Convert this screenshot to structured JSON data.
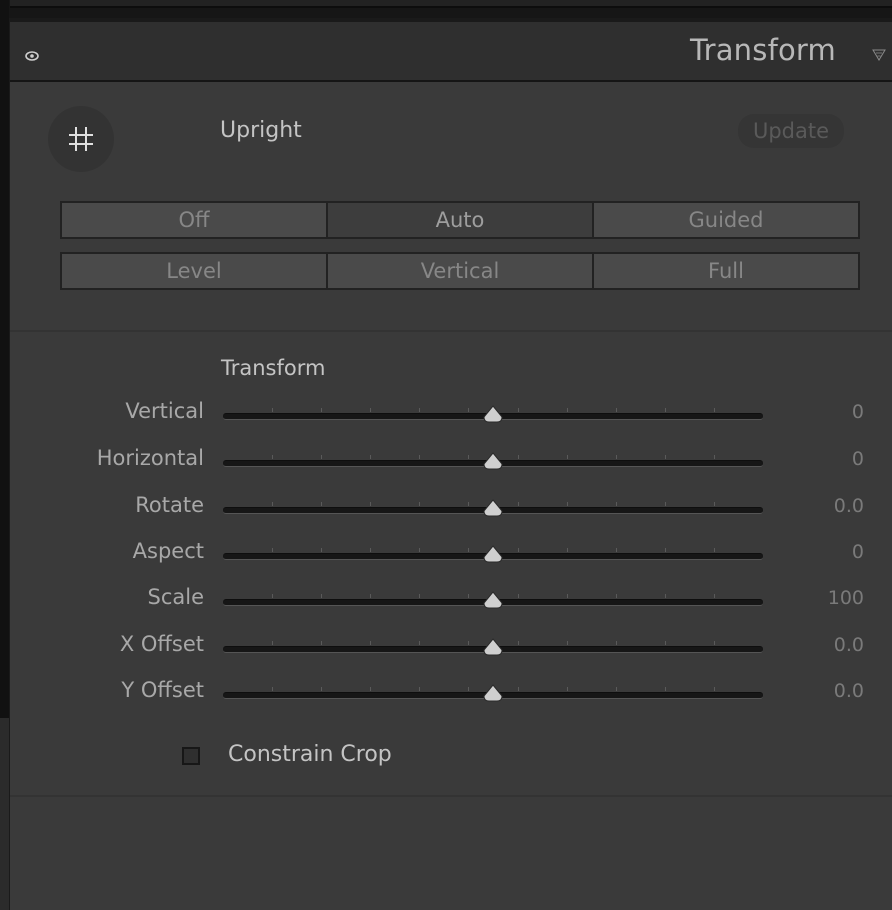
{
  "header": {
    "title": "Transform",
    "visibility_icon": "eye-icon",
    "collapse_icon": "triangle-down-icon"
  },
  "upright": {
    "tool_icon": "crop-grid-icon",
    "label": "Upright",
    "update_label": "Update",
    "modes_row1": [
      "Off",
      "Auto",
      "Guided"
    ],
    "modes_row2": [
      "Level",
      "Vertical",
      "Full"
    ],
    "active_mode": "Auto"
  },
  "transform": {
    "section_title": "Transform",
    "sliders": [
      {
        "label": "Vertical",
        "value": "0",
        "level": 0.5
      },
      {
        "label": "Horizontal",
        "value": "0",
        "level": 0.5
      },
      {
        "label": "Rotate",
        "value": "0.0",
        "level": 0.5
      },
      {
        "label": "Aspect",
        "value": "0",
        "level": 0.5
      },
      {
        "label": "Scale",
        "value": "100",
        "level": 0.5
      },
      {
        "label": "X Offset",
        "value": "0.0",
        "level": 0.5
      },
      {
        "label": "Y Offset",
        "value": "0.0",
        "level": 0.5
      }
    ],
    "constrain_crop": {
      "label": "Constrain Crop",
      "checked": false
    }
  },
  "colors": {
    "panel_bg": "#3a3a3a",
    "header_bg": "#2f2f2f",
    "text_primary": "#c4c4c4",
    "text_muted": "#7a7a7a"
  }
}
